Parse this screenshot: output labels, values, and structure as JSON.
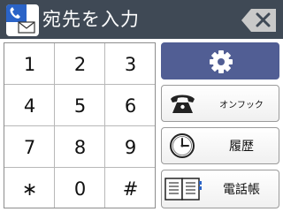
{
  "header": {
    "title": "宛先を入力",
    "fax_icon": "phone-envelope-icon",
    "backspace_icon": "backspace-x-icon"
  },
  "keypad": {
    "keys": [
      "1",
      "2",
      "3",
      "4",
      "5",
      "6",
      "7",
      "8",
      "9",
      "∗",
      "0",
      "#"
    ]
  },
  "side_buttons": {
    "settings_icon": "gear-icon",
    "onhook_label": "オンフック",
    "onhook_icon": "telephone-icon",
    "history_label": "履歴",
    "history_icon": "clock-icon",
    "phonebook_label": "電話帳",
    "phonebook_icon": "address-book-icon"
  },
  "colors": {
    "header_bg": "#3f4955",
    "settings_bg": "#515e94",
    "accent_blue": "#2a63c7"
  }
}
